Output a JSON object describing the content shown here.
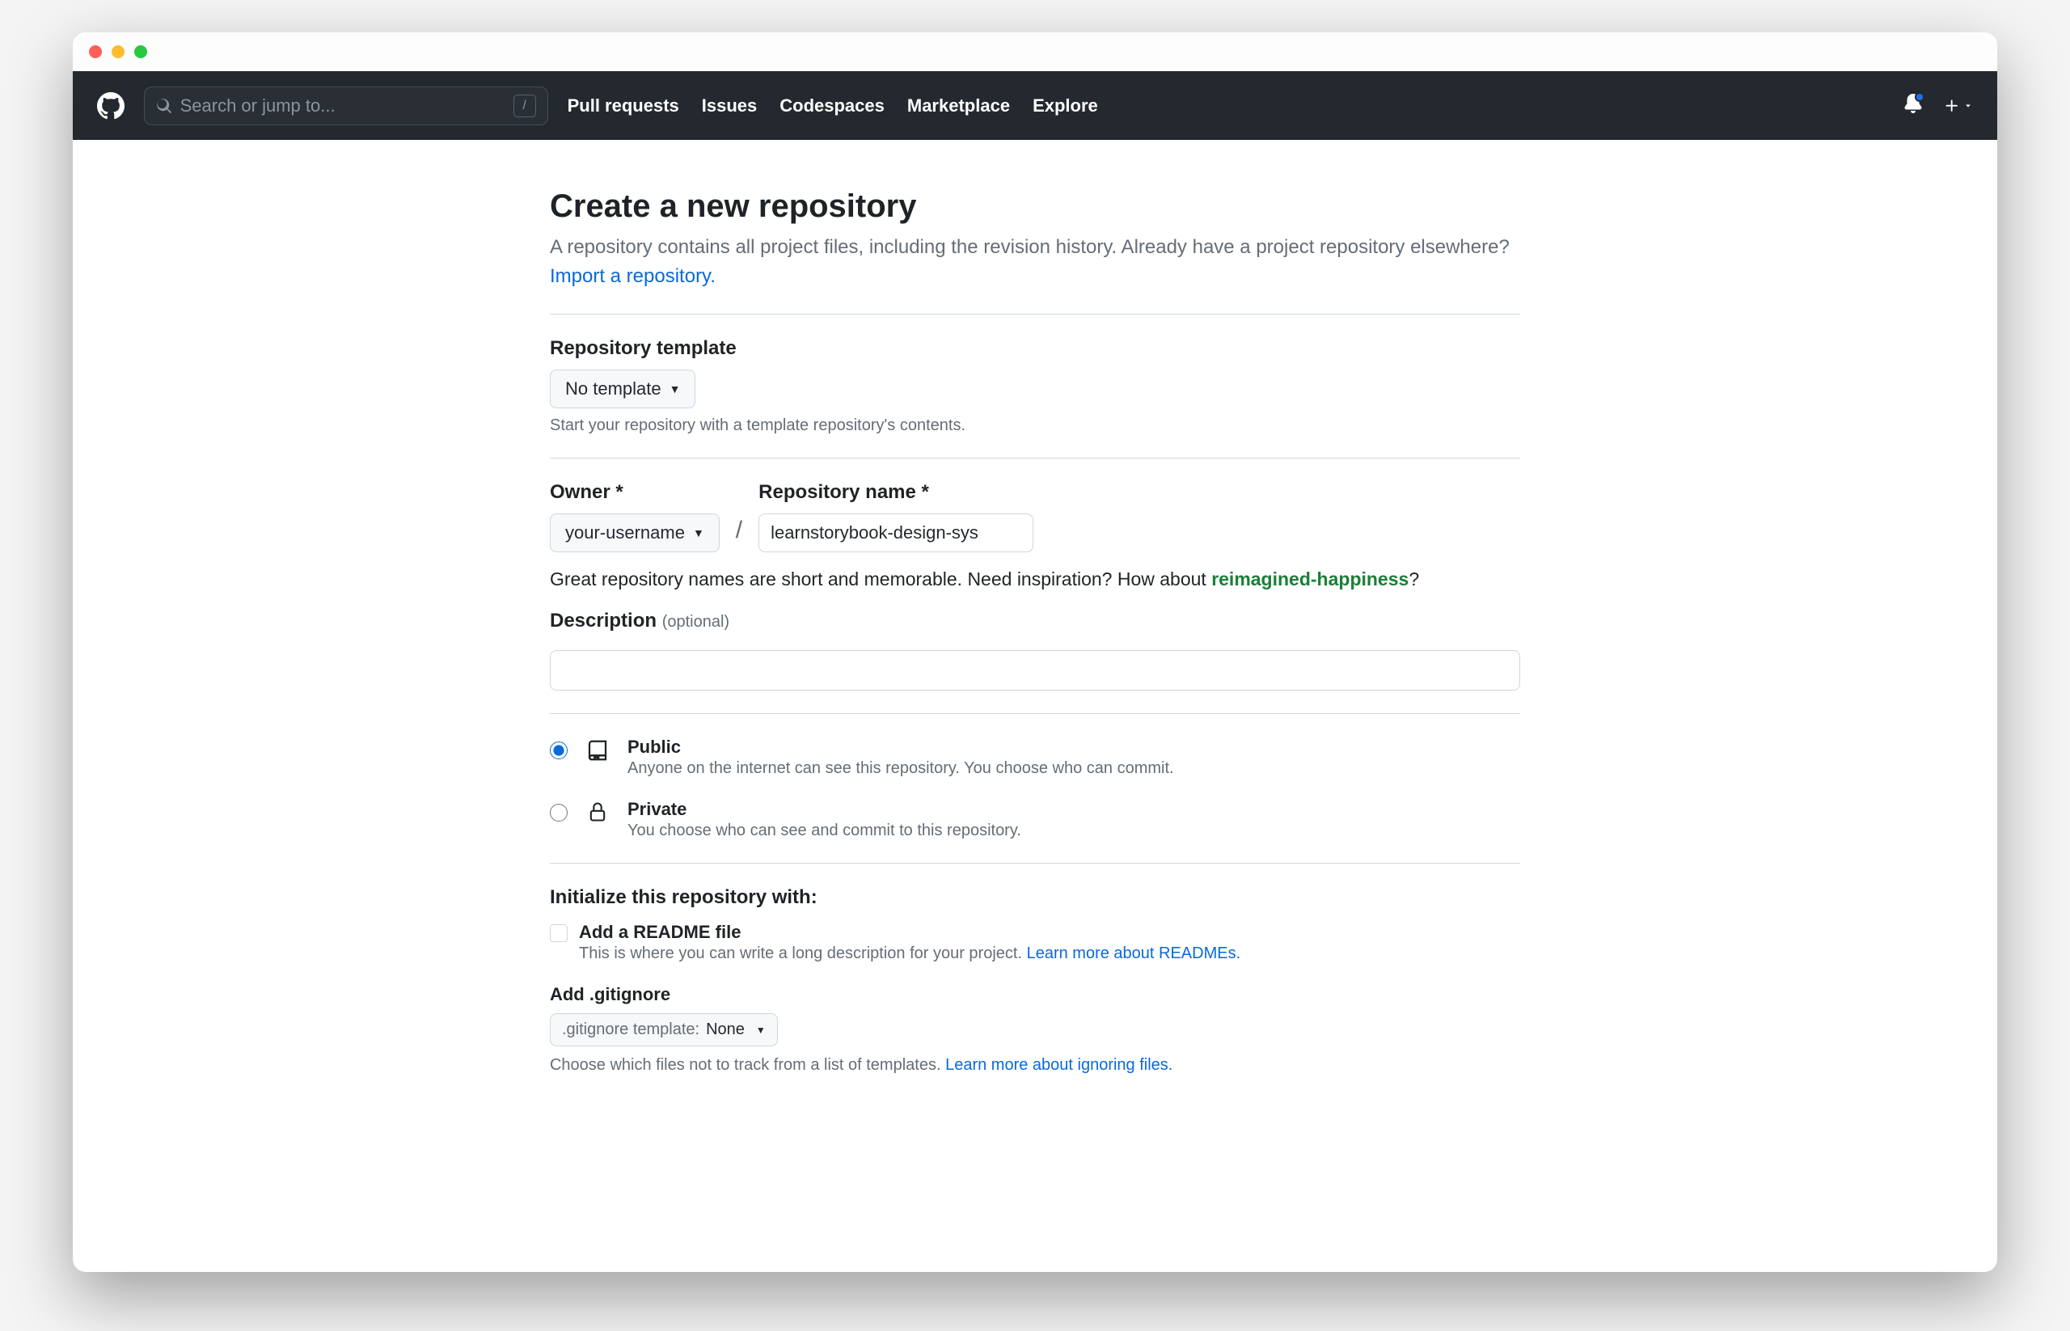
{
  "header": {
    "search_placeholder": "Search or jump to...",
    "slash_hint": "/",
    "nav": [
      "Pull requests",
      "Issues",
      "Codespaces",
      "Marketplace",
      "Explore"
    ]
  },
  "page": {
    "title": "Create a new repository",
    "subtitle_a": "A repository contains all project files, including the revision history. Already have a project repository elsewhere? ",
    "import_link": "Import a repository."
  },
  "template": {
    "label": "Repository template",
    "value": "No template",
    "hint": "Start your repository with a template repository's contents."
  },
  "owner": {
    "label": "Owner *",
    "value": "your-username"
  },
  "repo": {
    "label": "Repository name *",
    "value": "learnstorybook-design-sys"
  },
  "name_hint": {
    "pre": "Great repository names are short and memorable. Need inspiration? How about ",
    "suggestion": "reimagined-happiness",
    "post": "?"
  },
  "description": {
    "label": "Description",
    "optional": "(optional)",
    "value": ""
  },
  "visibility": {
    "public": {
      "title": "Public",
      "desc": "Anyone on the internet can see this repository. You choose who can commit."
    },
    "private": {
      "title": "Private",
      "desc": "You choose who can see and commit to this repository."
    }
  },
  "init": {
    "title": "Initialize this repository with:",
    "readme": {
      "title": "Add a README file",
      "desc": "This is where you can write a long description for your project. ",
      "link": "Learn more about READMEs."
    }
  },
  "gitignore": {
    "label": "Add .gitignore",
    "prefix": ".gitignore template: ",
    "value": "None",
    "hint_pre": "Choose which files not to track from a list of templates. ",
    "hint_link": "Learn more about ignoring files."
  }
}
